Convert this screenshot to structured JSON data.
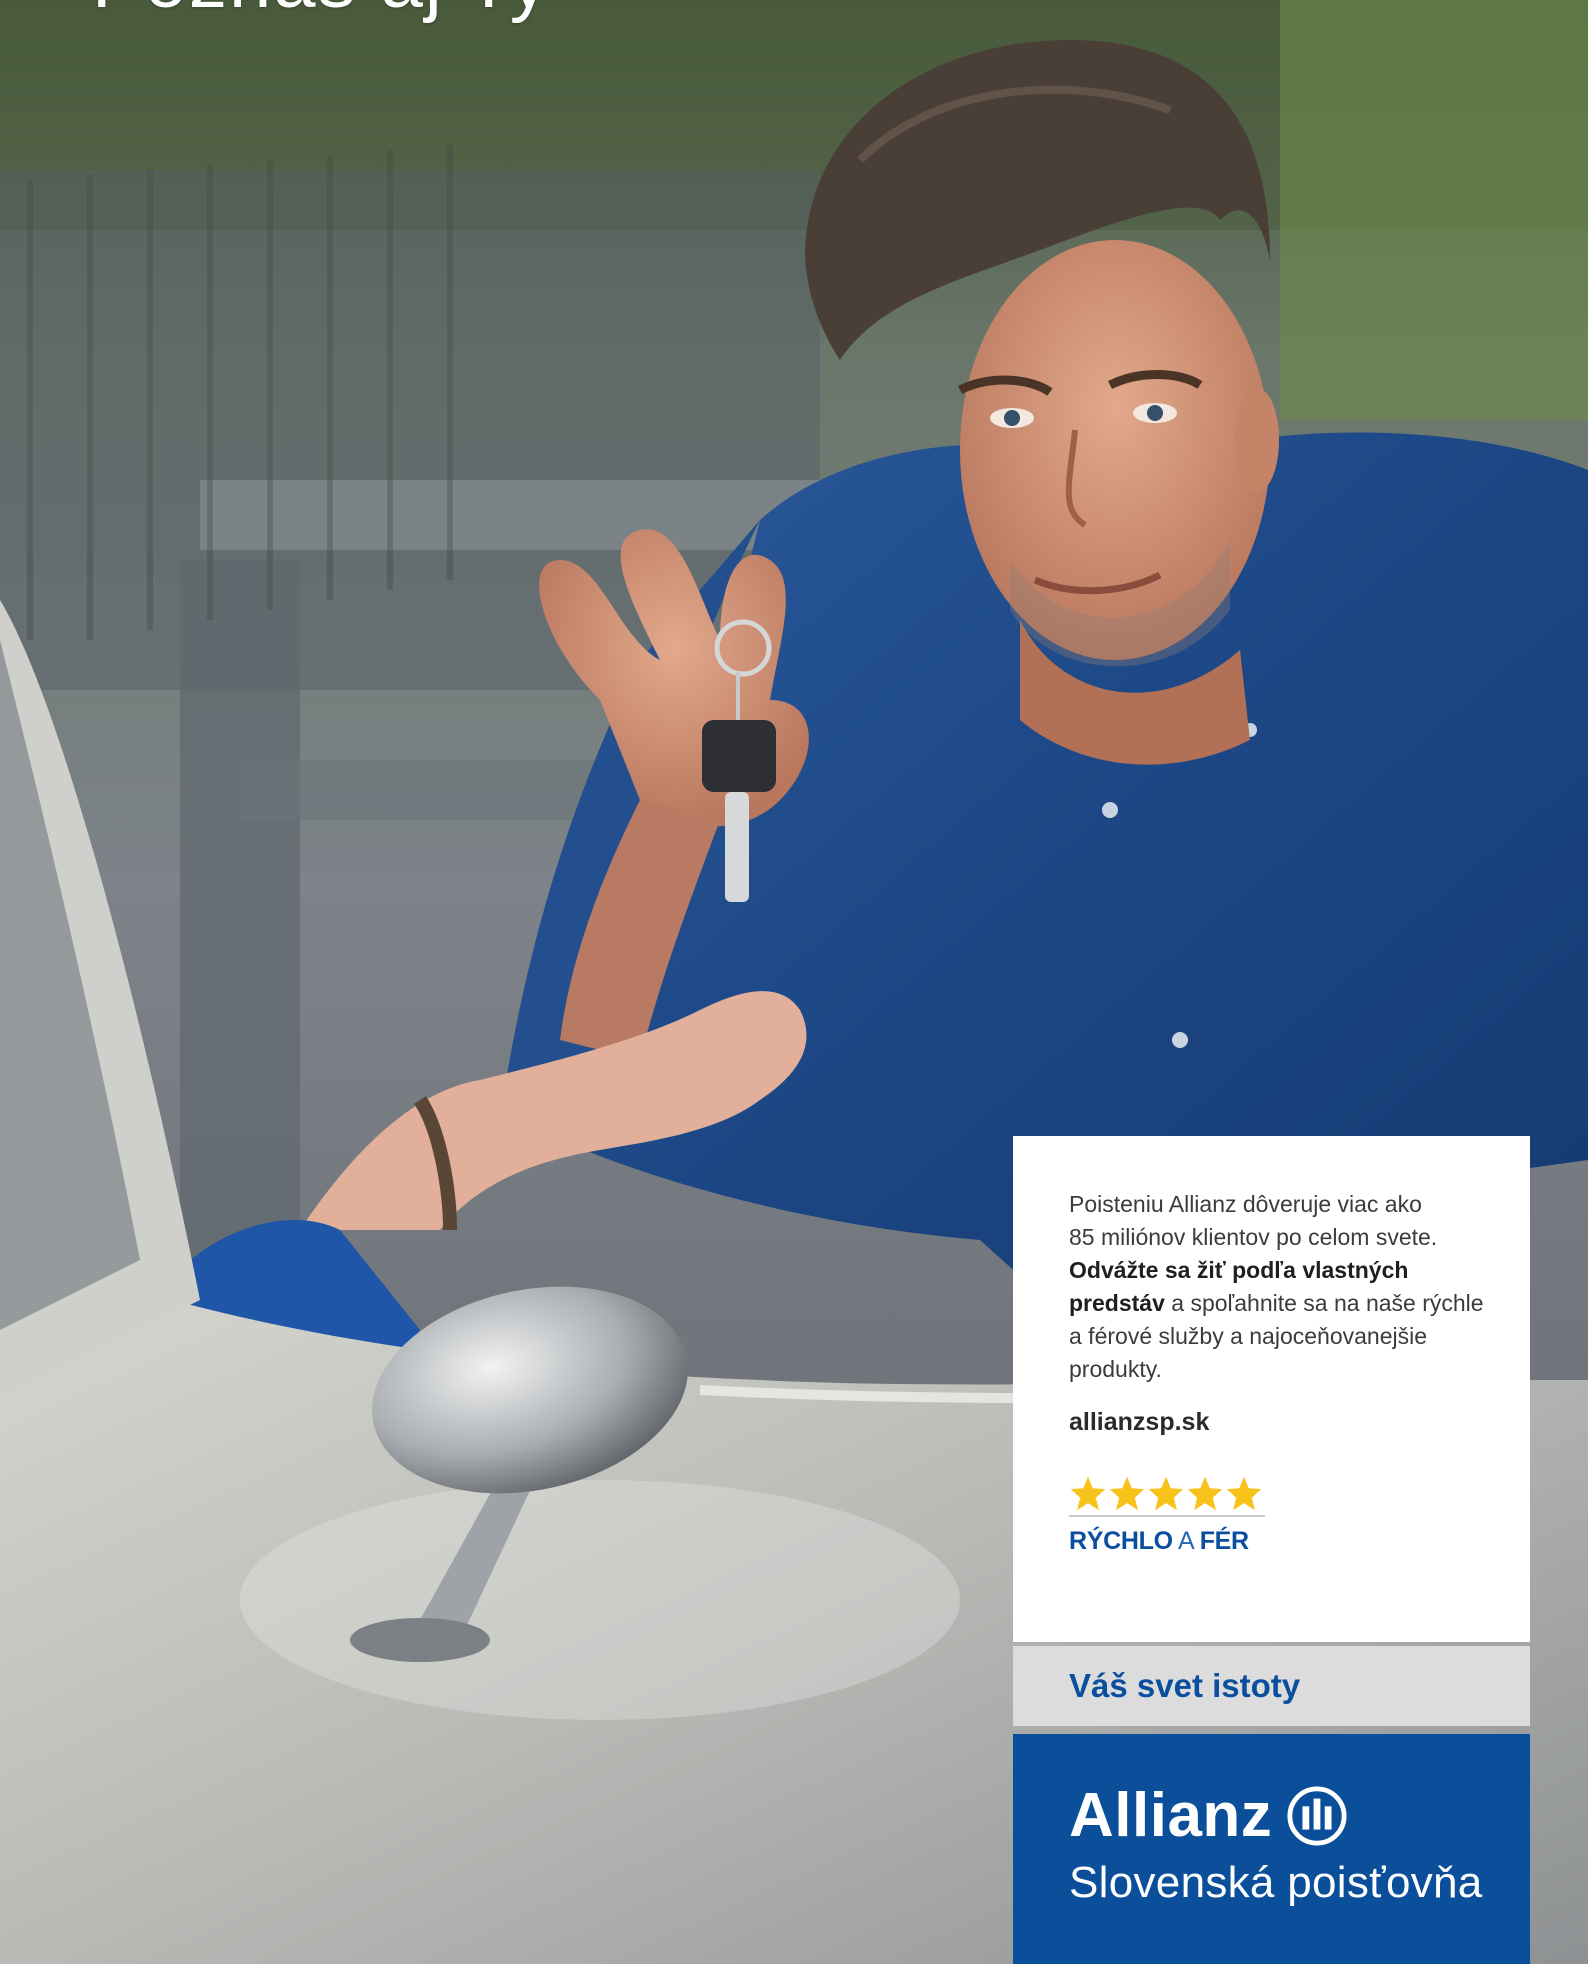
{
  "headline": "Poznáš aj Ty",
  "info_card": {
    "text_line1": "Poisteniu Allianz dôveruje viac ako",
    "text_line2": "85 miliónov klientov po celom svete.",
    "text_bold": "Odvážte sa žiť podľa vlastných predstáv",
    "text_rest": " a spoľahnite sa na naše rýchle a férové služby a najoceňovanejšie produkty.",
    "website": "allianzsp.sk"
  },
  "rating": {
    "stars": 5,
    "star_color": "#f7c21a",
    "label_part1": "RÝCHLO",
    "label_part2": " A ",
    "label_part3": "FÉR"
  },
  "tagline": "Váš svet istoty",
  "brand": {
    "name": "Allianz",
    "subtitle": "Slovenská poisťovňa",
    "color": "#0b4f9b",
    "emblem": "allianz-eagle-emblem"
  }
}
